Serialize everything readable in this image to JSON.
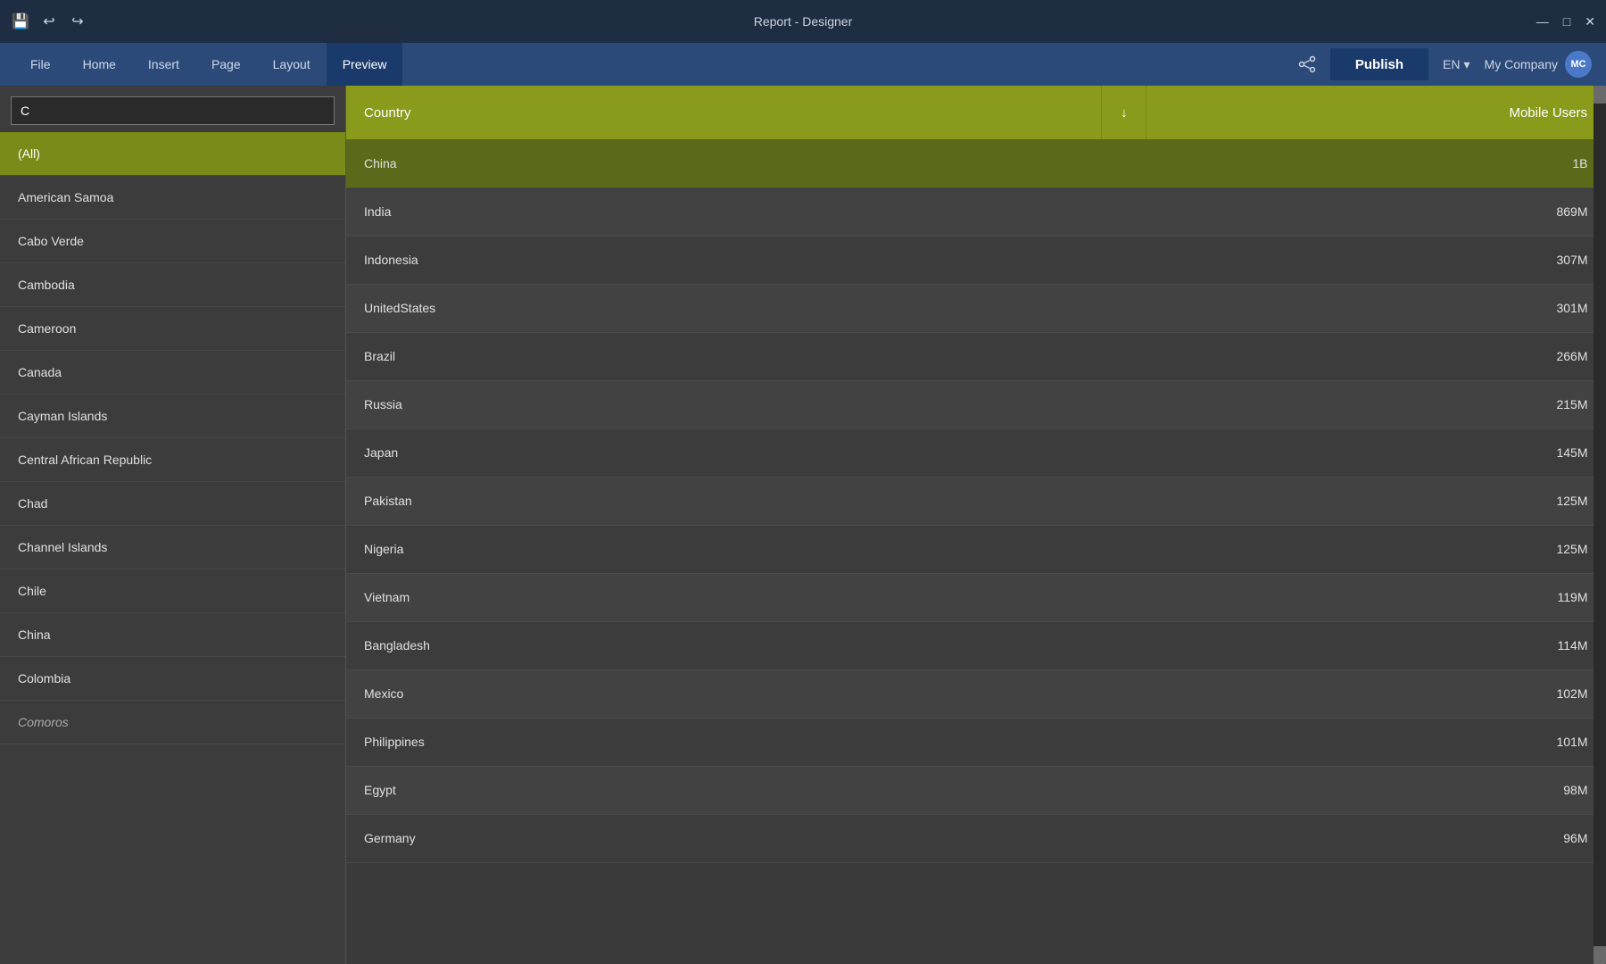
{
  "titleBar": {
    "title": "Report - Designer",
    "icons": {
      "save": "💾",
      "undo": "↩",
      "redo": "↪"
    },
    "controls": {
      "minimize": "—",
      "maximize": "□",
      "close": "✕"
    }
  },
  "menuBar": {
    "items": [
      {
        "label": "File",
        "active": false
      },
      {
        "label": "Home",
        "active": false
      },
      {
        "label": "Insert",
        "active": false
      },
      {
        "label": "Page",
        "active": false
      },
      {
        "label": "Layout",
        "active": false
      },
      {
        "label": "Preview",
        "active": true
      }
    ],
    "right": {
      "publish": "Publish",
      "lang": "EN",
      "langArrow": "▾",
      "user": "My Company",
      "avatar": "MC"
    }
  },
  "filterPanel": {
    "searchValue": "C",
    "searchPlaceholder": "",
    "items": [
      {
        "label": "(All)",
        "selected": true
      },
      {
        "label": "American Samoa",
        "selected": false
      },
      {
        "label": "Cabo Verde",
        "selected": false
      },
      {
        "label": "Cambodia",
        "selected": false
      },
      {
        "label": "Cameroon",
        "selected": false
      },
      {
        "label": "Canada",
        "selected": false
      },
      {
        "label": "Cayman Islands",
        "selected": false
      },
      {
        "label": "Central African Republic",
        "selected": false
      },
      {
        "label": "Chad",
        "selected": false
      },
      {
        "label": "Channel Islands",
        "selected": false
      },
      {
        "label": "Chile",
        "selected": false
      },
      {
        "label": "China",
        "selected": false
      },
      {
        "label": "Colombia",
        "selected": false
      },
      {
        "label": "Comoros",
        "selected": false
      }
    ]
  },
  "table": {
    "columns": [
      {
        "label": "Country",
        "key": "country"
      },
      {
        "label": "↓",
        "key": "sort"
      },
      {
        "label": "Mobile Users",
        "key": "users"
      }
    ],
    "rows": [
      {
        "country": "China",
        "users": "1B"
      },
      {
        "country": "India",
        "users": "869M"
      },
      {
        "country": "Indonesia",
        "users": "307M"
      },
      {
        "country": "UnitedStates",
        "users": "301M"
      },
      {
        "country": "Brazil",
        "users": "266M"
      },
      {
        "country": "Russia",
        "users": "215M"
      },
      {
        "country": "Japan",
        "users": "145M"
      },
      {
        "country": "Pakistan",
        "users": "125M"
      },
      {
        "country": "Nigeria",
        "users": "125M"
      },
      {
        "country": "Vietnam",
        "users": "119M"
      },
      {
        "country": "Bangladesh",
        "users": "114M"
      },
      {
        "country": "Mexico",
        "users": "102M"
      },
      {
        "country": "Philippines",
        "users": "101M"
      },
      {
        "country": "Egypt",
        "users": "98M"
      },
      {
        "country": "Germany",
        "users": "96M"
      }
    ]
  }
}
